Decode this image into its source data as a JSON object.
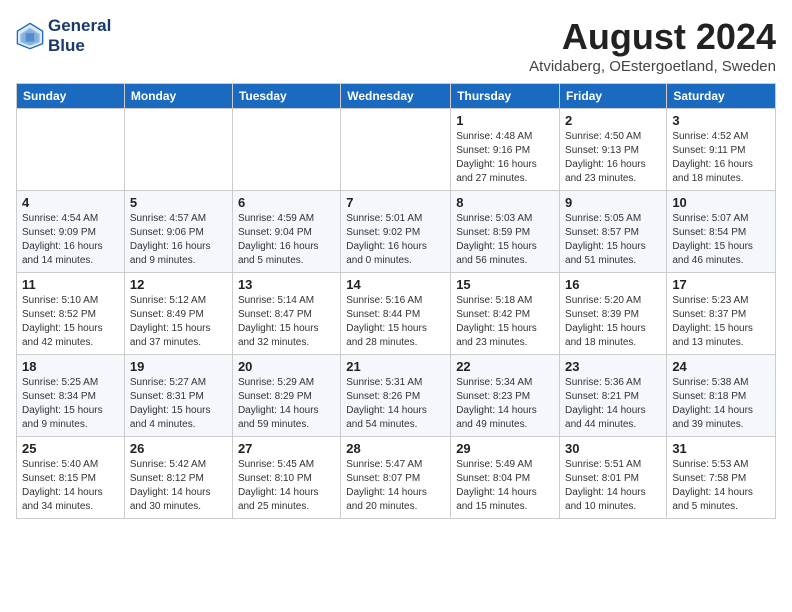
{
  "logo": {
    "line1": "General",
    "line2": "Blue"
  },
  "title": "August 2024",
  "subtitle": "Atvidaberg, OEstergoetland, Sweden",
  "weekdays": [
    "Sunday",
    "Monday",
    "Tuesday",
    "Wednesday",
    "Thursday",
    "Friday",
    "Saturday"
  ],
  "weeks": [
    [
      {
        "day": "",
        "content": ""
      },
      {
        "day": "",
        "content": ""
      },
      {
        "day": "",
        "content": ""
      },
      {
        "day": "",
        "content": ""
      },
      {
        "day": "1",
        "content": "Sunrise: 4:48 AM\nSunset: 9:16 PM\nDaylight: 16 hours\nand 27 minutes."
      },
      {
        "day": "2",
        "content": "Sunrise: 4:50 AM\nSunset: 9:13 PM\nDaylight: 16 hours\nand 23 minutes."
      },
      {
        "day": "3",
        "content": "Sunrise: 4:52 AM\nSunset: 9:11 PM\nDaylight: 16 hours\nand 18 minutes."
      }
    ],
    [
      {
        "day": "4",
        "content": "Sunrise: 4:54 AM\nSunset: 9:09 PM\nDaylight: 16 hours\nand 14 minutes."
      },
      {
        "day": "5",
        "content": "Sunrise: 4:57 AM\nSunset: 9:06 PM\nDaylight: 16 hours\nand 9 minutes."
      },
      {
        "day": "6",
        "content": "Sunrise: 4:59 AM\nSunset: 9:04 PM\nDaylight: 16 hours\nand 5 minutes."
      },
      {
        "day": "7",
        "content": "Sunrise: 5:01 AM\nSunset: 9:02 PM\nDaylight: 16 hours\nand 0 minutes."
      },
      {
        "day": "8",
        "content": "Sunrise: 5:03 AM\nSunset: 8:59 PM\nDaylight: 15 hours\nand 56 minutes."
      },
      {
        "day": "9",
        "content": "Sunrise: 5:05 AM\nSunset: 8:57 PM\nDaylight: 15 hours\nand 51 minutes."
      },
      {
        "day": "10",
        "content": "Sunrise: 5:07 AM\nSunset: 8:54 PM\nDaylight: 15 hours\nand 46 minutes."
      }
    ],
    [
      {
        "day": "11",
        "content": "Sunrise: 5:10 AM\nSunset: 8:52 PM\nDaylight: 15 hours\nand 42 minutes."
      },
      {
        "day": "12",
        "content": "Sunrise: 5:12 AM\nSunset: 8:49 PM\nDaylight: 15 hours\nand 37 minutes."
      },
      {
        "day": "13",
        "content": "Sunrise: 5:14 AM\nSunset: 8:47 PM\nDaylight: 15 hours\nand 32 minutes."
      },
      {
        "day": "14",
        "content": "Sunrise: 5:16 AM\nSunset: 8:44 PM\nDaylight: 15 hours\nand 28 minutes."
      },
      {
        "day": "15",
        "content": "Sunrise: 5:18 AM\nSunset: 8:42 PM\nDaylight: 15 hours\nand 23 minutes."
      },
      {
        "day": "16",
        "content": "Sunrise: 5:20 AM\nSunset: 8:39 PM\nDaylight: 15 hours\nand 18 minutes."
      },
      {
        "day": "17",
        "content": "Sunrise: 5:23 AM\nSunset: 8:37 PM\nDaylight: 15 hours\nand 13 minutes."
      }
    ],
    [
      {
        "day": "18",
        "content": "Sunrise: 5:25 AM\nSunset: 8:34 PM\nDaylight: 15 hours\nand 9 minutes."
      },
      {
        "day": "19",
        "content": "Sunrise: 5:27 AM\nSunset: 8:31 PM\nDaylight: 15 hours\nand 4 minutes."
      },
      {
        "day": "20",
        "content": "Sunrise: 5:29 AM\nSunset: 8:29 PM\nDaylight: 14 hours\nand 59 minutes."
      },
      {
        "day": "21",
        "content": "Sunrise: 5:31 AM\nSunset: 8:26 PM\nDaylight: 14 hours\nand 54 minutes."
      },
      {
        "day": "22",
        "content": "Sunrise: 5:34 AM\nSunset: 8:23 PM\nDaylight: 14 hours\nand 49 minutes."
      },
      {
        "day": "23",
        "content": "Sunrise: 5:36 AM\nSunset: 8:21 PM\nDaylight: 14 hours\nand 44 minutes."
      },
      {
        "day": "24",
        "content": "Sunrise: 5:38 AM\nSunset: 8:18 PM\nDaylight: 14 hours\nand 39 minutes."
      }
    ],
    [
      {
        "day": "25",
        "content": "Sunrise: 5:40 AM\nSunset: 8:15 PM\nDaylight: 14 hours\nand 34 minutes."
      },
      {
        "day": "26",
        "content": "Sunrise: 5:42 AM\nSunset: 8:12 PM\nDaylight: 14 hours\nand 30 minutes."
      },
      {
        "day": "27",
        "content": "Sunrise: 5:45 AM\nSunset: 8:10 PM\nDaylight: 14 hours\nand 25 minutes."
      },
      {
        "day": "28",
        "content": "Sunrise: 5:47 AM\nSunset: 8:07 PM\nDaylight: 14 hours\nand 20 minutes."
      },
      {
        "day": "29",
        "content": "Sunrise: 5:49 AM\nSunset: 8:04 PM\nDaylight: 14 hours\nand 15 minutes."
      },
      {
        "day": "30",
        "content": "Sunrise: 5:51 AM\nSunset: 8:01 PM\nDaylight: 14 hours\nand 10 minutes."
      },
      {
        "day": "31",
        "content": "Sunrise: 5:53 AM\nSunset: 7:58 PM\nDaylight: 14 hours\nand 5 minutes."
      }
    ]
  ]
}
